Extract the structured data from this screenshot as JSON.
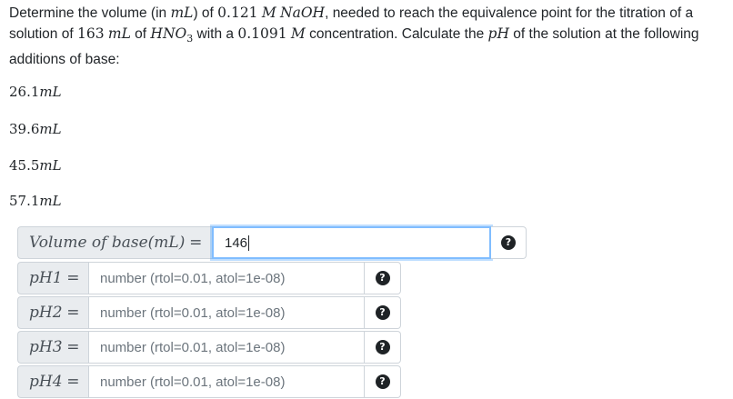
{
  "question": {
    "part1": "Determine the volume (in ",
    "unit_ml": "mL",
    "part2": ") of ",
    "conc_base": "0.121",
    "unit_M": "M",
    "base": "NaOH",
    "part3": ", needed to reach the equivalence point for the titration of a solution of ",
    "vol_acid": "163",
    "unit_ml_2": "mL",
    "part4": " of ",
    "acid": "HNO",
    "acid_sub": "3",
    "part5": " with a ",
    "conc_acid": "0.1091",
    "unit_M_2": "M",
    "part6": " concentration. Calculate the ",
    "ph": "pH",
    "part7": " of the solution at the following additions of base:"
  },
  "additions": [
    {
      "value": "26.1",
      "unit": "mL"
    },
    {
      "value": "39.6",
      "unit": "mL"
    },
    {
      "value": "45.5",
      "unit": "mL"
    },
    {
      "value": "57.1",
      "unit": "mL"
    }
  ],
  "volume_input": {
    "label_text": "Volume of base ",
    "label_unit": "(mL)",
    "equals": "=",
    "value": "146"
  },
  "ph_inputs": [
    {
      "label": "pH1",
      "equals": "=",
      "placeholder": "number (rtol=0.01, atol=1e-08)"
    },
    {
      "label": "pH2",
      "equals": "=",
      "placeholder": "number (rtol=0.01, atol=1e-08)"
    },
    {
      "label": "pH3",
      "equals": "=",
      "placeholder": "number (rtol=0.01, atol=1e-08)"
    },
    {
      "label": "pH4",
      "equals": "=",
      "placeholder": "number (rtol=0.01, atol=1e-08)"
    }
  ],
  "help_icon": "question-circle-icon",
  "colors": {
    "text": "#212529",
    "addon_bg": "#e9ecef",
    "border": "#ced4da",
    "focus_border": "#80bdff",
    "icon": "#1f2326"
  }
}
